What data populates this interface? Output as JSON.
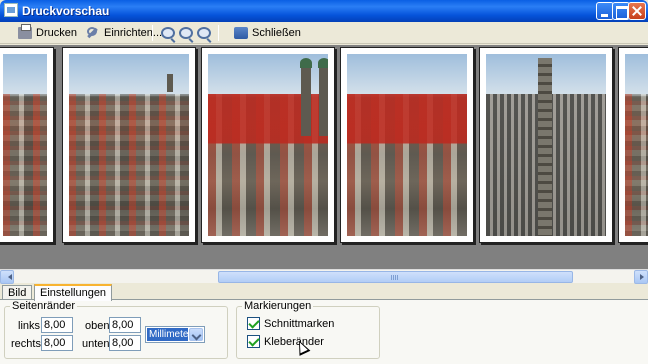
{
  "window": {
    "title": "Druckvorschau"
  },
  "toolbar": {
    "print_label": "Drucken",
    "setup_label": "Einrichten...",
    "close_label": "Schließen"
  },
  "tabs": [
    {
      "label": "Bild",
      "active": false
    },
    {
      "label": "Einstellungen",
      "active": true
    }
  ],
  "margins": {
    "legend": "Seitenränder",
    "left_label": "links:",
    "left_value": "8,00",
    "top_label": "oben:",
    "top_value": "8,00",
    "right_label": "rechts:",
    "right_value": "8,00",
    "bottom_label": "unten:",
    "bottom_value": "8,00",
    "unit_selected": "Millimeter"
  },
  "markings": {
    "legend": "Markierungen",
    "cut_marks_label": "Schnittmarken",
    "cut_marks_checked": true,
    "glue_edges_label": "Kleberänder",
    "glue_edges_checked": true
  },
  "scroll": {
    "position": 0.5
  },
  "colors": {
    "titlebar": "#0553da",
    "active_tab": "#f8b330",
    "selection": "#316ac5"
  }
}
